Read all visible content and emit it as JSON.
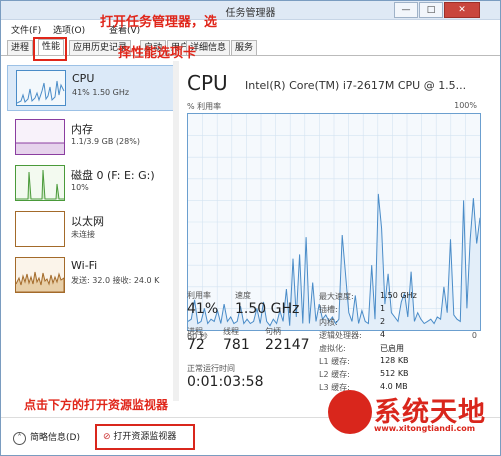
{
  "window": {
    "title": "任务管理器",
    "min": "—",
    "max": "□",
    "close": "✕"
  },
  "menu": [
    "文件(F)",
    "选项(O)",
    "查看(V)"
  ],
  "tabs": [
    "进程",
    "性能",
    "应用历史记录",
    "启动",
    "用户",
    "详细信息",
    "服务"
  ],
  "sidebar": {
    "items": [
      {
        "name": "CPU",
        "sub": "41% 1.50 GHz"
      },
      {
        "name": "内存",
        "sub": "1.1/3.9 GB (28%)"
      },
      {
        "name": "磁盘 0 (F: E: G:)",
        "sub": "10%"
      },
      {
        "name": "以太网",
        "sub": "未连接"
      },
      {
        "name": "Wi-Fi",
        "sub": "发送: 32.0  接收: 24.0 K"
      }
    ]
  },
  "main": {
    "title": "CPU",
    "model": "Intel(R) Core(TM) i7-2617M CPU @ 1.5...",
    "util_label": "% 利用率",
    "pct_max": "100%",
    "axis_left": "60 秒",
    "axis_right": "0",
    "stats": {
      "util_label": "利用率",
      "util": "41%",
      "speed_label": "速度",
      "speed": "1.50 GHz",
      "proc_label": "进程",
      "proc": "72",
      "thread_label": "线程",
      "thread": "781",
      "handle_label": "句柄",
      "handle": "22147",
      "uptime_label": "正常运行时间",
      "uptime": "0:01:03:58"
    },
    "specs": [
      {
        "k": "最大速度:",
        "v": "1.50 GHz"
      },
      {
        "k": "插槽:",
        "v": "1"
      },
      {
        "k": "内核:",
        "v": "2"
      },
      {
        "k": "逻辑处理器:",
        "v": "4"
      },
      {
        "k": "虚拟化:",
        "v": "已启用"
      },
      {
        "k": "L1 缓存:",
        "v": "128 KB"
      },
      {
        "k": "L2 缓存:",
        "v": "512 KB"
      },
      {
        "k": "L3 缓存:",
        "v": "4.0 MB"
      }
    ]
  },
  "footer": {
    "brief": "简略信息(D)",
    "resmon": "打开资源监视器"
  },
  "annotations": {
    "top1": "打开任务管理器，选",
    "top2": "择性能选项卡",
    "bottom": "点击下方的打开资源监视器"
  },
  "logo": {
    "text": "系统天地",
    "url": "www.xitongtiandi.com"
  },
  "colors": {
    "cpu": "#4a8cc8",
    "memory": "#8b3ea0",
    "disk": "#4a9a3a",
    "network": "#a36a2a",
    "annotation": "#e0261a"
  },
  "cpu_graph": [
    4,
    5,
    14,
    3,
    4,
    10,
    3,
    5,
    4,
    9,
    3,
    12,
    4,
    6,
    3,
    4,
    11,
    3,
    5,
    3,
    4,
    10,
    3,
    13,
    4,
    2,
    5,
    3,
    9,
    4,
    19,
    2,
    33,
    6,
    35,
    3,
    43,
    3,
    22,
    4,
    12,
    5,
    7,
    4,
    6,
    3,
    5,
    44,
    26,
    8,
    4,
    16,
    3,
    9,
    4,
    3,
    30,
    5,
    63,
    47,
    12,
    26,
    8,
    6,
    4,
    13,
    17,
    6,
    27,
    4,
    8,
    5,
    3,
    4,
    5,
    3,
    6,
    5,
    20,
    8,
    42,
    7,
    5,
    4,
    60,
    10,
    42,
    61,
    40,
    52
  ]
}
